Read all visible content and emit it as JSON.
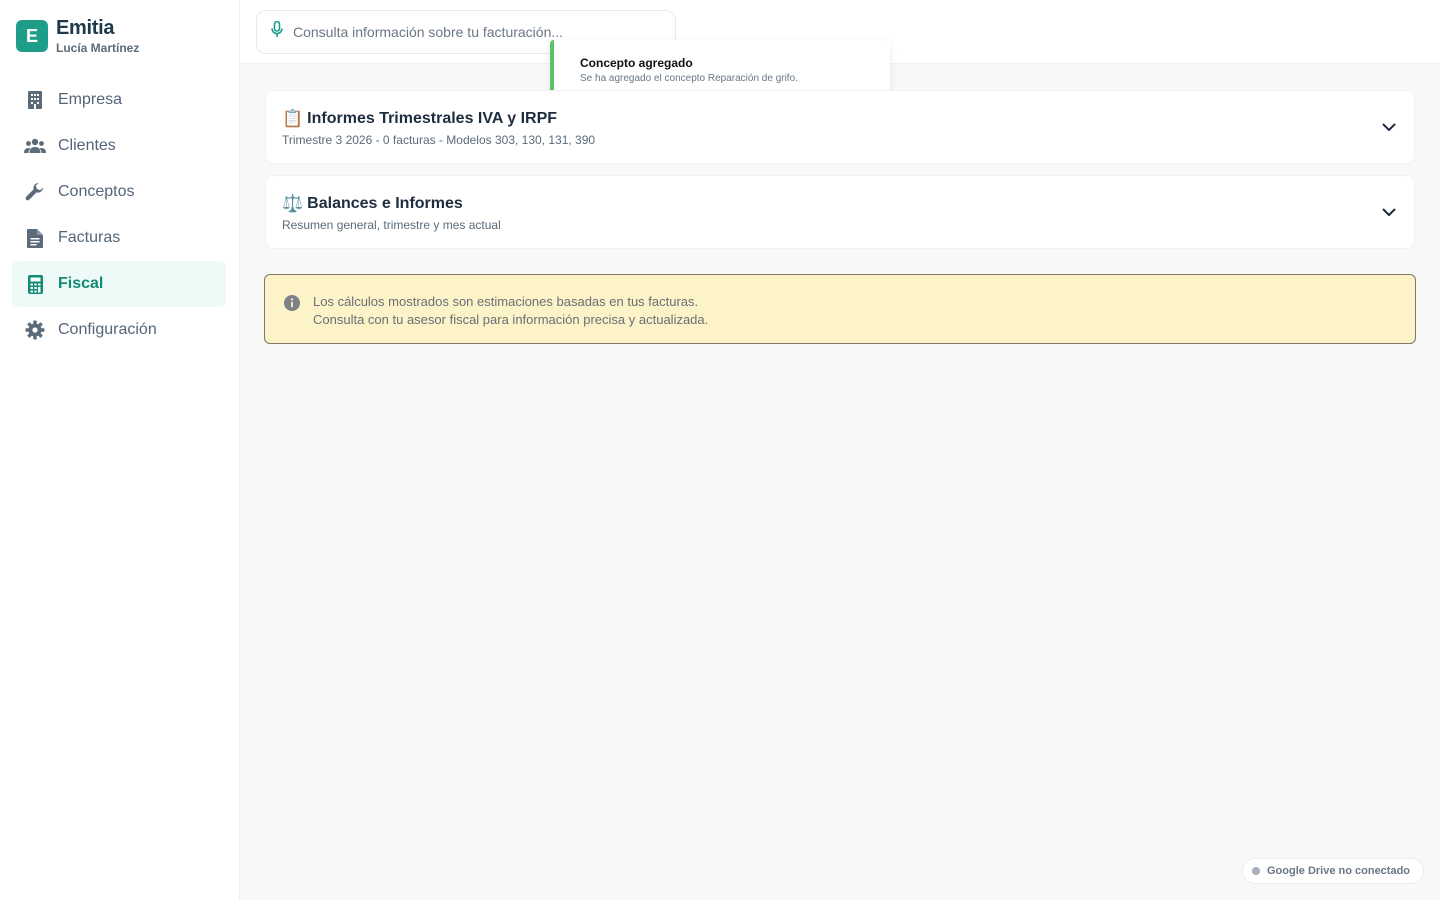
{
  "app": {
    "name": "Emitia",
    "logo_letter": "E",
    "user": "Lucía Martínez",
    "accent": "#1e9e8a"
  },
  "sidebar": {
    "items": [
      {
        "label": "Empresa",
        "icon": "building-icon",
        "active": false
      },
      {
        "label": "Clientes",
        "icon": "users-icon",
        "active": false
      },
      {
        "label": "Conceptos",
        "icon": "wrench-icon",
        "active": false
      },
      {
        "label": "Facturas",
        "icon": "document-icon",
        "active": false
      },
      {
        "label": "Fiscal",
        "icon": "calculator-icon",
        "active": true
      },
      {
        "label": "Configuración",
        "icon": "gear-icon",
        "active": false
      }
    ]
  },
  "search": {
    "placeholder": "Consulta información sobre tu facturación...",
    "icon": "microphone-icon"
  },
  "toast": {
    "title": "Concepto agregado",
    "message": "Se ha agregado el concepto Reparación de grifo.",
    "color": "#59c26b"
  },
  "cards": [
    {
      "emoji": "📋",
      "title": "Informes Trimestrales IVA y IRPF",
      "subtitle": "Trimestre 3 2026 - 0 facturas - Modelos 303, 130, 131, 390"
    },
    {
      "emoji": "⚖️",
      "title": "Balances e Informes",
      "subtitle": "Resumen general, trimestre y mes actual"
    }
  ],
  "notice": {
    "line1": "Los cálculos mostrados son estimaciones basadas en tus facturas.",
    "line2": "Consulta con tu asesor fiscal para información precisa y actualizada.",
    "background": "#fdf3c8"
  },
  "drive_status": {
    "label": "Google Drive no conectado"
  }
}
